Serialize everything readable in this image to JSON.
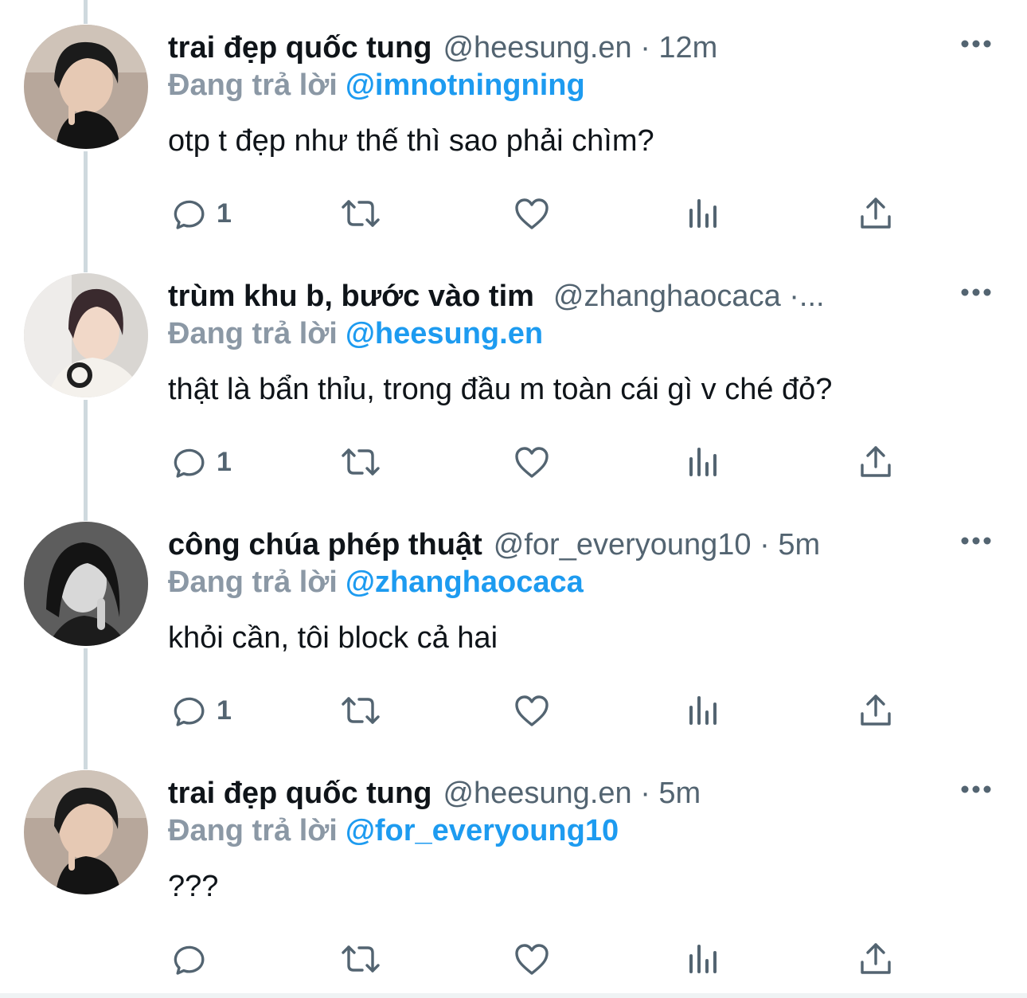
{
  "reply_prefix": "Đang trả lời",
  "colors": {
    "accent": "#1d9bf0",
    "muted": "#536471",
    "text": "#0f1419",
    "thread_line": "#cfd9de"
  },
  "tweets": [
    {
      "name": "trai đẹp quốc tung",
      "meta": "@heesung.en · 12m",
      "reply_to": "@imnotningning",
      "text": "otp t đẹp như thế thì sao phải chìm?",
      "reply_count": "1",
      "avatar": "avatar-boy-dark-hair"
    },
    {
      "name": "trùm khu b, bước vào tim",
      "meta": "@zhanghaocaca ·...",
      "reply_to": "@heesung.en",
      "text": "thật là bẩn thỉu, trong đầu m toàn cái gì v ché đỏ?",
      "reply_count": "1",
      "avatar": "avatar-boy-headphones"
    },
    {
      "name": "công chúa phép thuật",
      "meta": "@for_everyoung10 · 5m",
      "reply_to": "@zhanghaocaca",
      "text": "khỏi cần, tôi block cả hai",
      "reply_count": "1",
      "avatar": "avatar-girl-bw"
    },
    {
      "name": "trai đẹp quốc tung",
      "meta": "@heesung.en · 5m",
      "reply_to": "@for_everyoung10",
      "text": "???",
      "reply_count": "",
      "avatar": "avatar-boy-dark-hair"
    }
  ],
  "icons": {
    "reply": "reply-icon",
    "retweet": "retweet-icon",
    "like": "like-icon",
    "views": "views-icon",
    "share": "share-icon",
    "more": "more-icon"
  }
}
